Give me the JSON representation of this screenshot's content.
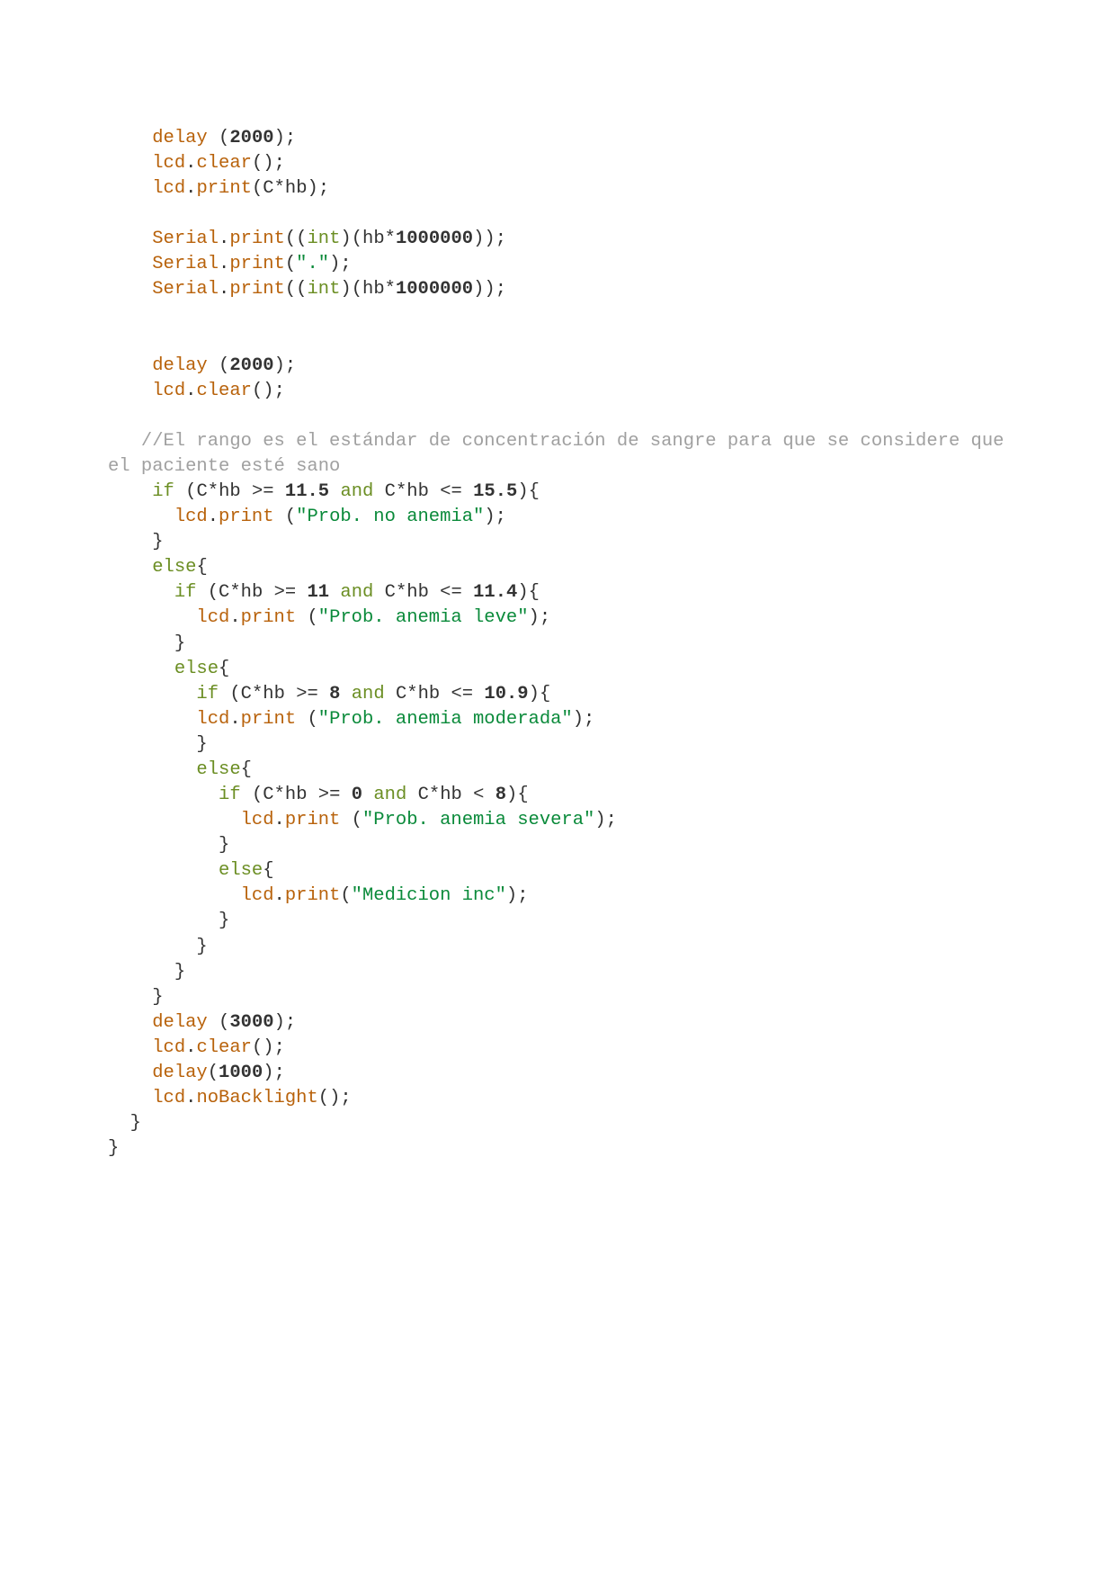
{
  "code": {
    "line1": "    delay (2000);",
    "line2": "    lcd.clear();",
    "line3": "    lcd.print(C*hb);",
    "line4": "",
    "line5": "    Serial.print((int)(hb*1000000));",
    "line6": "    Serial.print(\".\");",
    "line7": "    Serial.print((int)(hb*1000000));",
    "line8": "",
    "line9": "",
    "line10": "    delay (2000);",
    "line11": "    lcd.clear();",
    "line12": "",
    "line13": "   //El rango es el estándar de concentración de sangre para que se considere que el paciente esté sano",
    "line14": "    if (C*hb >= 11.5 and C*hb <= 15.5){",
    "line15": "      lcd.print (\"Prob. no anemia\");",
    "line16": "    }",
    "line17": "    else{",
    "line18": "      if (C*hb >= 11 and C*hb <= 11.4){",
    "line19": "        lcd.print (\"Prob. anemia leve\");",
    "line20": "      }",
    "line21": "      else{",
    "line22": "        if (C*hb >= 8 and C*hb <= 10.9){",
    "line23": "        lcd.print (\"Prob. anemia moderada\");",
    "line24": "        }",
    "line25": "        else{",
    "line26": "          if (C*hb >= 0 and C*hb < 8){",
    "line27": "            lcd.print (\"Prob. anemia severa\");",
    "line28": "          }",
    "line29": "          else{",
    "line30": "            lcd.print(\"Medicion inc\");",
    "line31": "          }",
    "line32": "        }",
    "line33": "      }",
    "line34": "    }",
    "line35": "    delay (3000);",
    "line36": "    lcd.clear();",
    "line37": "    delay(1000);",
    "line38": "    lcd.noBacklight();",
    "line39": "  }",
    "line40": "}"
  },
  "tokens": {
    "delay": "delay",
    "lcd": "lcd",
    "clear": "clear",
    "print": "print",
    "Serial": "Serial",
    "int": "int",
    "if": "if",
    "else": "else",
    "and": "and",
    "noBacklight": "noBacklight"
  },
  "numbers": {
    "n2000": "2000",
    "n1000000": "1000000",
    "n11_5": "11.5",
    "n15_5": "15.5",
    "n11": "11",
    "n11_4": "11.4",
    "n8": "8",
    "n10_9": "10.9",
    "n0": "0",
    "n3000": "3000",
    "n1000": "1000"
  },
  "strings": {
    "dot": "\".\"",
    "no_anemia": "\"Prob. no anemia\"",
    "leve": "\"Prob. anemia leve\"",
    "moderada": "\"Prob. anemia moderada\"",
    "severa": "\"Prob. anemia severa\"",
    "medicion": "\"Medicion inc\""
  },
  "comment": "//El rango es el estándar de concentración de sangre para que se considere que el paciente esté sano",
  "punct": {
    "sp4": "    ",
    "sp3": "   ",
    "sp6": "      ",
    "sp8": "        ",
    "sp10": "          ",
    "sp12": "            ",
    "sp2": "  ",
    "lp": "(",
    "rp": ")",
    "lb": "{",
    "rb": "}",
    "semi": ";",
    "dot": ".",
    "star": "*",
    "ge": " >= ",
    "le": " <= ",
    "lt": " < ",
    "C": "C",
    "hb": "hb",
    "sp": " "
  }
}
